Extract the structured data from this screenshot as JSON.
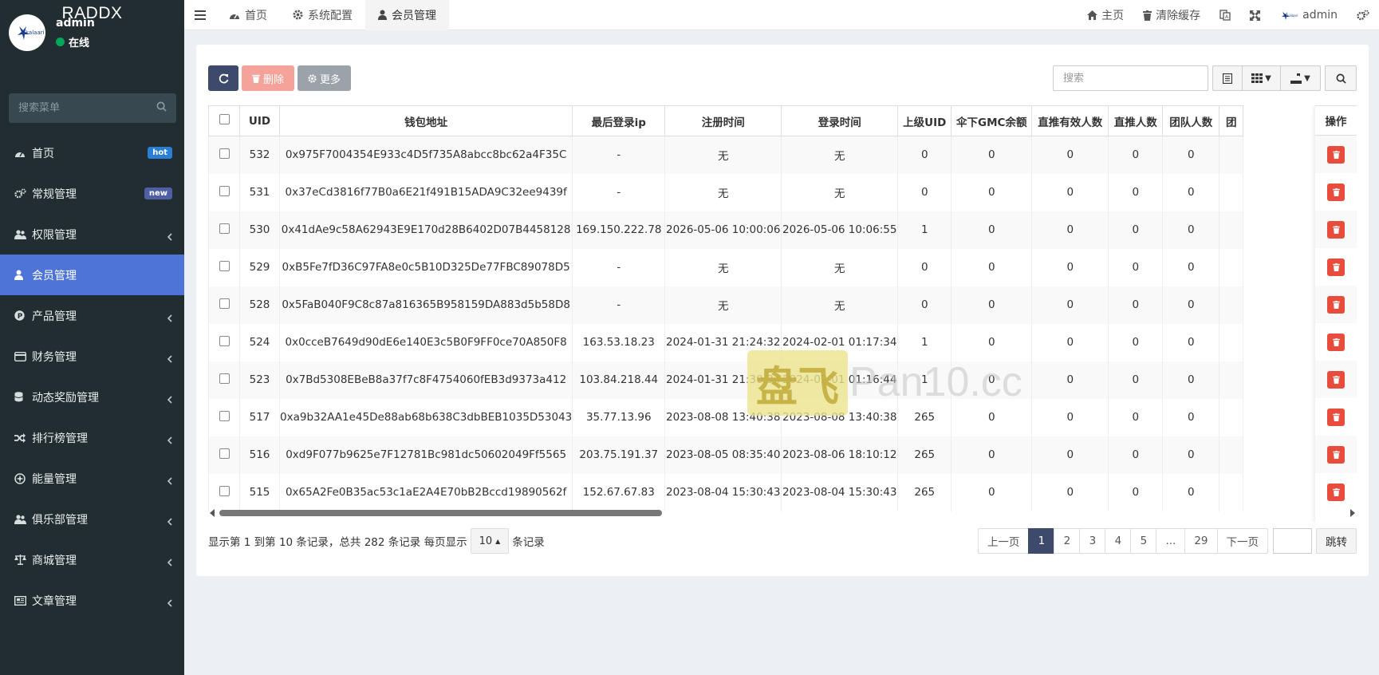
{
  "app": {
    "logo": "RADDX"
  },
  "user": {
    "name": "admin",
    "status": "在线"
  },
  "sidebar": {
    "search_placeholder": "搜索菜单",
    "items": [
      {
        "label": "首页",
        "icon": "dashboard-icon",
        "badge": "hot"
      },
      {
        "label": "常规管理",
        "icon": "cogs-icon",
        "badge": "new"
      },
      {
        "label": "权限管理",
        "icon": "users-icon",
        "chevron": true
      },
      {
        "label": "会员管理",
        "icon": "user-icon",
        "active": true
      },
      {
        "label": "产品管理",
        "icon": "product-icon",
        "chevron": true
      },
      {
        "label": "财务管理",
        "icon": "credit-card-icon",
        "chevron": true
      },
      {
        "label": "动态奖励管理",
        "icon": "database-icon",
        "chevron": true
      },
      {
        "label": "排行榜管理",
        "icon": "random-icon",
        "chevron": true
      },
      {
        "label": "能量管理",
        "icon": "energy-icon",
        "chevron": true
      },
      {
        "label": "俱乐部管理",
        "icon": "club-icon",
        "chevron": true
      },
      {
        "label": "商城管理",
        "icon": "balance-scale-icon",
        "chevron": true
      },
      {
        "label": "文章管理",
        "icon": "newspaper-icon",
        "chevron": true
      }
    ]
  },
  "header": {
    "tabs": [
      {
        "label": "首页",
        "icon": "dashboard-icon"
      },
      {
        "label": "系统配置",
        "icon": "cog-icon"
      },
      {
        "label": "会员管理",
        "icon": "user-icon",
        "active": true
      }
    ],
    "right": {
      "home": "主页",
      "clear_cache": "清除缓存",
      "admin": "admin"
    }
  },
  "toolbar": {
    "delete_label": "删除",
    "more_label": "更多",
    "search_placeholder": "搜索"
  },
  "table": {
    "columns": [
      "UID",
      "钱包地址",
      "最后登录ip",
      "注册时间",
      "登录时间",
      "上级UID",
      "伞下GMC余额",
      "直推有效人数",
      "直推人数",
      "团队人数",
      "团"
    ],
    "op_header": "操作",
    "rows": [
      [
        "532",
        "0x975F7004354E933c4D5f735A8abcc8bc62a4F35C",
        "-",
        "无",
        "无",
        "0",
        "0",
        "0",
        "0",
        "0",
        ""
      ],
      [
        "531",
        "0x37eCd3816f77B0a6E21f491B15ADA9C32ee9439f",
        "-",
        "无",
        "无",
        "0",
        "0",
        "0",
        "0",
        "0",
        ""
      ],
      [
        "530",
        "0x41dAe9c58A62943E9E170d28B6402D07B4458128",
        "169.150.222.78",
        "2026-05-06 10:00:06",
        "2026-05-06 10:06:55",
        "1",
        "0",
        "0",
        "0",
        "0",
        ""
      ],
      [
        "529",
        "0xB5Fe7fD36C97FA8e0c5B10D325De77FBC89078D5",
        "-",
        "无",
        "无",
        "0",
        "0",
        "0",
        "0",
        "0",
        ""
      ],
      [
        "528",
        "0x5FaB040F9C8c87a816365B958159DA883d5b58D8",
        "-",
        "无",
        "无",
        "0",
        "0",
        "0",
        "0",
        "0",
        ""
      ],
      [
        "524",
        "0x0cceB7649d90dE6e140E3c5B0F9FF0ce70A850F8",
        "163.53.18.23",
        "2024-01-31 21:24:32",
        "2024-02-01 01:17:34",
        "1",
        "0",
        "0",
        "0",
        "0",
        ""
      ],
      [
        "523",
        "0x7Bd5308EBeB8a37f7c8F4754060fEB3d9373a412",
        "103.84.218.44",
        "2024-01-31 21:30:34",
        "2024-02-01 01:16:44",
        "1",
        "0",
        "0",
        "0",
        "0",
        ""
      ],
      [
        "517",
        "0xa9b32AA1e45De88ab68b638C3dbBEB1035D53043",
        "35.77.13.96",
        "2023-08-08 13:40:38",
        "2023-08-08 13:40:38",
        "265",
        "0",
        "0",
        "0",
        "0",
        ""
      ],
      [
        "516",
        "0xd9F077b9625e7F12781Bc981dc50602049Ff5565",
        "203.75.191.37",
        "2023-08-05 08:35:40",
        "2023-08-06 18:10:12",
        "265",
        "0",
        "0",
        "0",
        "0",
        ""
      ],
      [
        "515",
        "0x65A2Fe0B35ac53c1aE2A4E70bB2Bccd19890562f",
        "152.67.67.83",
        "2023-08-04 15:30:43",
        "2023-08-04 15:30:43",
        "265",
        "0",
        "0",
        "0",
        "0",
        ""
      ]
    ]
  },
  "pagination": {
    "info_prefix": "显示第 1 到第 10 条记录，总共 282 条记录 每页显示",
    "page_size": "10",
    "info_suffix": "条记录",
    "prev": "上一页",
    "pages": [
      "1",
      "2",
      "3",
      "4",
      "5",
      "...",
      "29"
    ],
    "current": "1",
    "next": "下一页",
    "jump": "跳转"
  },
  "watermark": {
    "glyph": "盘飞",
    "text": "Pan10.cc"
  },
  "colors": {
    "sidebar_bg": "#222d32",
    "active_menu": "#4e74d7",
    "primary_btn": "#3e4a6b",
    "danger": "#e74c3c",
    "online": "#00a65a"
  }
}
